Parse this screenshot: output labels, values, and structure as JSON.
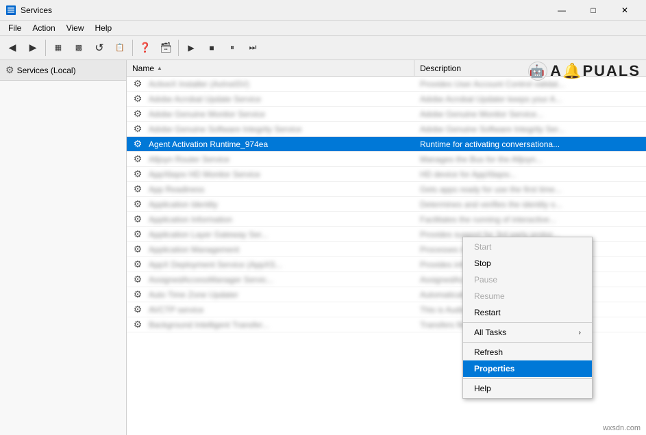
{
  "title_bar": {
    "title": "Services",
    "min_label": "—",
    "max_label": "□",
    "close_label": "✕"
  },
  "menu_bar": {
    "items": [
      "File",
      "Action",
      "View",
      "Help"
    ]
  },
  "toolbar": {
    "buttons": [
      {
        "name": "back-btn",
        "icon": "◀",
        "label": "Back"
      },
      {
        "name": "forward-btn",
        "icon": "▶",
        "label": "Forward"
      },
      {
        "name": "up-btn",
        "icon": "⬆",
        "label": "Up"
      },
      {
        "name": "show-hide-btn",
        "icon": "▦",
        "label": "Show/Hide"
      },
      {
        "name": "computer-btn",
        "icon": "💻",
        "label": "Computer"
      },
      {
        "name": "refresh-toolbar-btn",
        "icon": "↺",
        "label": "Refresh"
      },
      {
        "name": "export-btn",
        "icon": "📋",
        "label": "Export"
      },
      {
        "name": "help-btn",
        "icon": "❓",
        "label": "Help"
      },
      {
        "name": "properties-btn",
        "icon": "🗃",
        "label": "Properties"
      },
      {
        "name": "play-btn",
        "icon": "▶",
        "label": "Play"
      },
      {
        "name": "stop-btn",
        "icon": "■",
        "label": "Stop"
      },
      {
        "name": "pause-btn",
        "icon": "⏸",
        "label": "Pause"
      },
      {
        "name": "resume-btn",
        "icon": "⏭",
        "label": "Resume"
      }
    ]
  },
  "left_panel": {
    "header_label": "Services (Local)"
  },
  "list_header": {
    "name_col": "Name",
    "desc_col": "Description"
  },
  "services": [
    {
      "icon": "⚙",
      "name": "ActiveX Installer (AxInstSV)",
      "description": "Provides User Account Control validat...",
      "blurred": true
    },
    {
      "icon": "⚙",
      "name": "Adobe Acrobat Update Service",
      "description": "Adobe Acrobat Updater keeps your A...",
      "blurred": true
    },
    {
      "icon": "⚙",
      "name": "Adobe Genuine Monitor Service",
      "description": "Adobe Genuine Monitor Service...",
      "blurred": true
    },
    {
      "icon": "⚙",
      "name": "Adobe Genuine Software Integrity Service",
      "description": "Adobe Genuine Software Integrity Ser...",
      "blurred": true
    },
    {
      "icon": "⚙",
      "name": "Agent Activation Runtime_974ea",
      "description": "Runtime for activating conversationa...",
      "blurred": false,
      "selected": true
    },
    {
      "icon": "⚙",
      "name": "Alljoyn Router Service",
      "description": "Manages the Bus for the Alljoyn...",
      "blurred": true
    },
    {
      "icon": "⚙",
      "name": "AppXbqov HD Monitor Service",
      "description": "HD device for AppXbqov...",
      "blurred": true
    },
    {
      "icon": "⚙",
      "name": "App Readiness",
      "description": "Gets apps ready for use the first time...",
      "blurred": true
    },
    {
      "icon": "⚙",
      "name": "Application Identity",
      "description": "Determines and verifies the identity o...",
      "blurred": true
    },
    {
      "icon": "⚙",
      "name": "Application Information",
      "description": "Facilitates the running of interactive...",
      "blurred": true
    },
    {
      "icon": "⚙",
      "name": "Application Layer Gateway Ser...",
      "description": "Provides support for 3rd party protoc...",
      "blurred": true
    },
    {
      "icon": "⚙",
      "name": "Application Management",
      "description": "Processes installation, removal and e...",
      "blurred": true
    },
    {
      "icon": "⚙",
      "name": "AppX Deployment Service (AppXS...",
      "description": "Provides infrastructure support for d...",
      "blurred": true
    },
    {
      "icon": "⚙",
      "name": "AssignedAccessManager Servic...",
      "description": "AssignedAccessManager Service co...",
      "blurred": true
    },
    {
      "icon": "⚙",
      "name": "Auto Time Zone Updater",
      "description": "Automatically sets the system time z...",
      "blurred": true
    },
    {
      "icon": "⚙",
      "name": "AVCTP service",
      "description": "This is Audio Video Control Transpor...",
      "blurred": true
    },
    {
      "icon": "⚙",
      "name": "Background Intelligent Transfer...",
      "description": "Transfers files in the background...",
      "blurred": true
    }
  ],
  "context_menu": {
    "items": [
      {
        "label": "Start",
        "enabled": false,
        "name": "ctx-start",
        "has_arrow": false
      },
      {
        "label": "Stop",
        "enabled": true,
        "name": "ctx-stop",
        "has_arrow": false
      },
      {
        "label": "Pause",
        "enabled": false,
        "name": "ctx-pause",
        "has_arrow": false
      },
      {
        "label": "Resume",
        "enabled": false,
        "name": "ctx-resume",
        "has_arrow": false
      },
      {
        "label": "Restart",
        "enabled": true,
        "name": "ctx-restart",
        "has_arrow": false
      },
      {
        "separator": true
      },
      {
        "label": "All Tasks",
        "enabled": true,
        "name": "ctx-all-tasks",
        "has_arrow": true
      },
      {
        "separator": true
      },
      {
        "label": "Refresh",
        "enabled": true,
        "name": "ctx-refresh",
        "has_arrow": false
      },
      {
        "label": "Properties",
        "enabled": true,
        "name": "ctx-properties",
        "has_arrow": false,
        "active": true
      },
      {
        "separator": true
      },
      {
        "label": "Help",
        "enabled": true,
        "name": "ctx-help",
        "has_arrow": false
      }
    ]
  },
  "watermark": "wxsdn.com"
}
